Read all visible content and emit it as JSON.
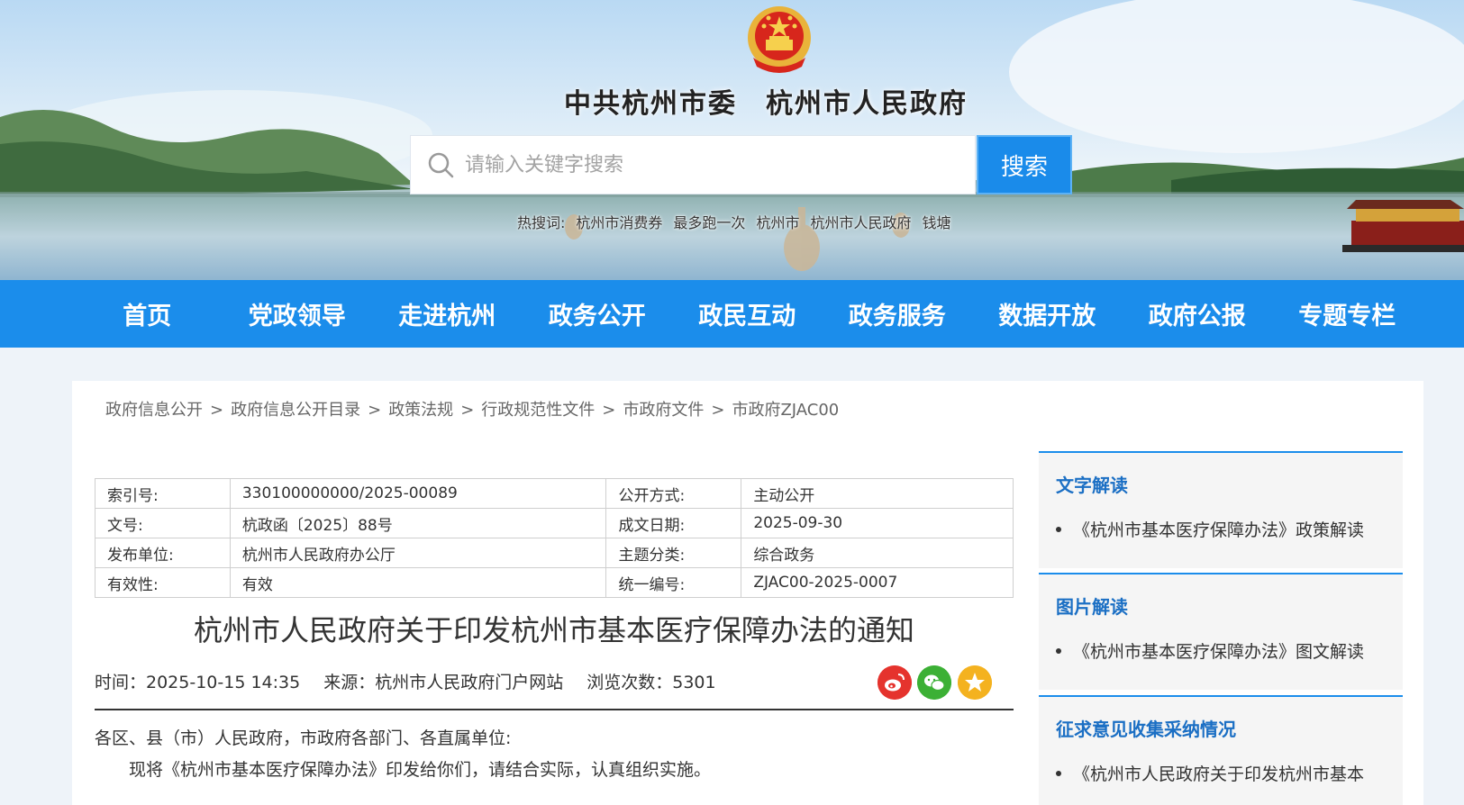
{
  "header": {
    "site_title": "中共杭州市委　杭州市人民政府",
    "search_placeholder": "请输入关键字搜索",
    "search_button": "搜索",
    "hot_search_label": "热搜词:",
    "hot_terms": [
      "杭州市消费券",
      "最多跑一次",
      "杭州市",
      "杭州市人民政府",
      "钱塘"
    ]
  },
  "nav": {
    "items": [
      "首页",
      "党政领导",
      "走进杭州",
      "政务公开",
      "政民互动",
      "政务服务",
      "数据开放",
      "政府公报",
      "专题专栏"
    ]
  },
  "breadcrumb": [
    "政府信息公开",
    "政府信息公开目录",
    "政策法规",
    "行政规范性文件",
    "市政府文件",
    "市政府ZJAC00"
  ],
  "meta": {
    "rows": [
      {
        "k1": "索引号:",
        "v1": "330100000000/2025-00089",
        "k2": "公开方式:",
        "v2": "主动公开"
      },
      {
        "k1": "文号:",
        "v1": "杭政函〔2025〕88号",
        "k2": "成文日期:",
        "v2": "2025-09-30"
      },
      {
        "k1": "发布单位:",
        "v1": "杭州市人民政府办公厅",
        "k2": "主题分类:",
        "v2": "综合政务"
      },
      {
        "k1": "有效性:",
        "v1": "有效",
        "k2": "统一编号:",
        "v2": "ZJAC00-2025-0007"
      }
    ]
  },
  "article": {
    "title": "杭州市人民政府关于印发杭州市基本医疗保障办法的通知",
    "time": "时间：2025-10-15 14:35",
    "source": "来源：杭州市人民政府门户网站",
    "views": "浏览次数：5301",
    "salutation": "各区、县（市）人民政府，市政府各部门、各直属单位:",
    "paragraph1": "现将《杭州市基本医疗保障办法》印发给你们，请结合实际，认真组织实施。"
  },
  "sidebar": {
    "sections": [
      {
        "title": "文字解读",
        "item": "《杭州市基本医疗保障办法》政策解读"
      },
      {
        "title": "图片解读",
        "item": "《杭州市基本医疗保障办法》图文解读"
      },
      {
        "title": "征求意见收集采纳情况",
        "item": "《杭州市人民政府关于印发杭州市基本"
      }
    ]
  },
  "colors": {
    "nav_bg": "#1b8deb",
    "accent_title": "#1b6fc4",
    "share_weibo": "#e5332d",
    "share_wechat": "#3cb035",
    "share_fav": "#f4b21f"
  }
}
